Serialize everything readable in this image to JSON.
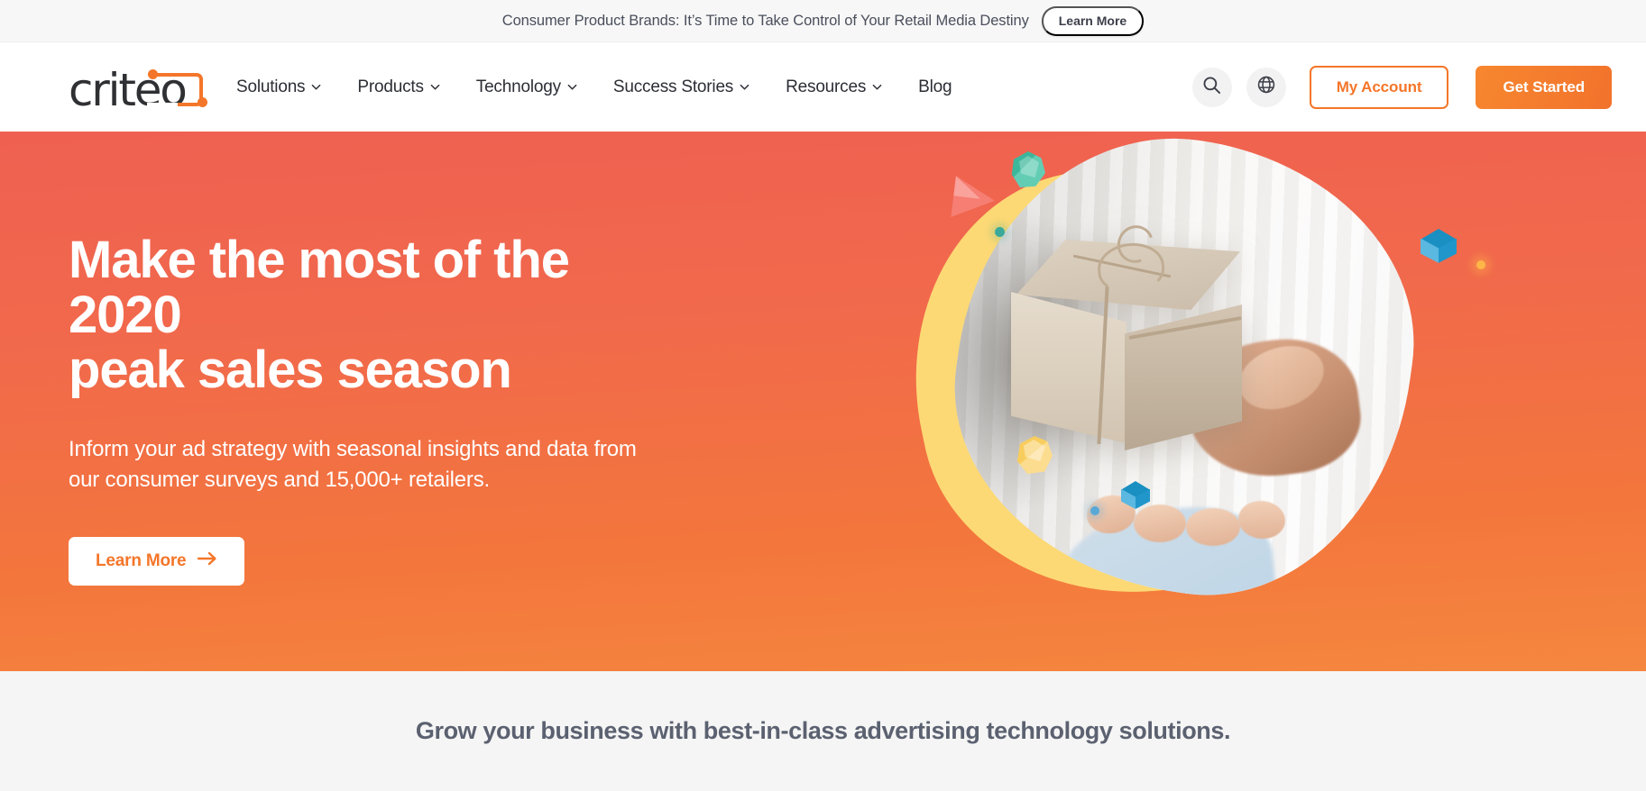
{
  "announcement": {
    "text": "Consumer Product Brands: It’s Time to Take Control of Your Retail Media Destiny",
    "cta_label": "Learn More"
  },
  "header": {
    "logo_word": "criteo",
    "logo_alt": "criteo",
    "nav_items": [
      {
        "label": "Solutions",
        "has_dropdown": true
      },
      {
        "label": "Products",
        "has_dropdown": true
      },
      {
        "label": "Technology",
        "has_dropdown": true
      },
      {
        "label": "Success Stories",
        "has_dropdown": true
      },
      {
        "label": "Resources",
        "has_dropdown": true
      },
      {
        "label": "Blog",
        "has_dropdown": false
      }
    ],
    "search_icon": "search-icon",
    "language_icon": "globe-icon",
    "account_label": "My Account",
    "get_started_label": "Get Started"
  },
  "hero": {
    "title_line1": "Make the most of the 2020",
    "title_line2": "peak sales season",
    "subtitle_line1": "Inform your ad strategy with seasonal insights and data from",
    "subtitle_line2": "our consumer surveys and 15,000+ retailers.",
    "cta_label": "Learn More",
    "cta_icon": "arrow-right-icon",
    "image_alt": "hand-holding-wrapped-gift-box"
  },
  "bottom_band": {
    "title": "Grow your business with best-in-class advertising technology solutions."
  },
  "colors": {
    "brand_orange": "#F4762A",
    "hero_gradient_top": "#EF6051",
    "hero_gradient_bottom": "#F5873F",
    "announcement_bg": "#F7F7F7",
    "band_bg": "#F5F5F5",
    "band_text": "#5B6170",
    "nav_text": "#2C2E35",
    "accent_yellow": "#FCD975",
    "accent_teal": "#3DB79B",
    "accent_blue": "#2196CB",
    "accent_pink": "#F68076"
  }
}
